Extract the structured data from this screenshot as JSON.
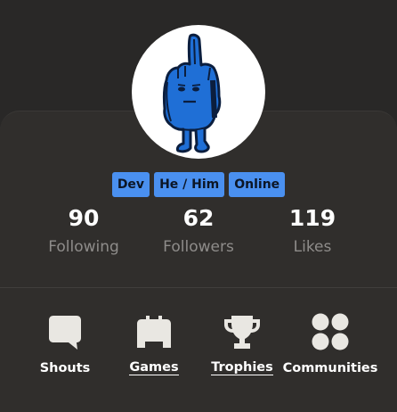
{
  "profile": {
    "badges": [
      "Dev",
      "He / Him",
      "Online"
    ],
    "badge_color": "#4a90f0"
  },
  "stats": {
    "following": {
      "value": "90",
      "label": "Following"
    },
    "followers": {
      "value": "62",
      "label": "Followers"
    },
    "likes": {
      "value": "119",
      "label": "Likes"
    }
  },
  "nav": {
    "shouts": {
      "label": "Shouts",
      "icon": "speech-bubble-icon"
    },
    "games": {
      "label": "Games",
      "icon": "gamepad-icon"
    },
    "trophies": {
      "label": "Trophies",
      "icon": "trophy-icon"
    },
    "communities": {
      "label": "Communities",
      "icon": "communities-icon"
    }
  }
}
